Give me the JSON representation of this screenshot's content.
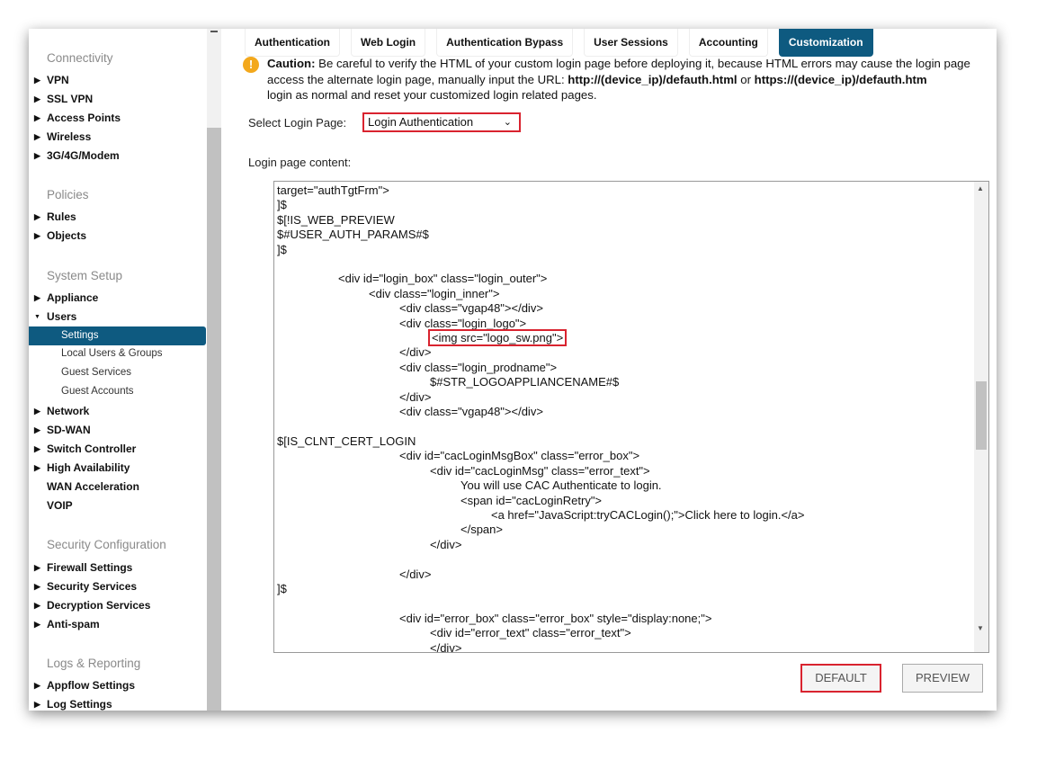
{
  "sidebar": {
    "sections": [
      {
        "title": "Connectivity",
        "items": [
          "VPN",
          "SSL VPN",
          "Access Points",
          "Wireless",
          "3G/4G/Modem"
        ]
      },
      {
        "title": "Policies",
        "items": [
          "Rules",
          "Objects"
        ]
      },
      {
        "title": "System Setup",
        "items": [
          "Appliance",
          "Users"
        ],
        "users_sub": [
          "Settings",
          "Local Users & Groups",
          "Guest Services",
          "Guest Accounts"
        ],
        "items2": [
          "Network",
          "SD-WAN",
          "Switch Controller",
          "High Availability",
          "WAN Acceleration",
          "VOIP"
        ]
      },
      {
        "title": "Security Configuration",
        "items": [
          "Firewall Settings",
          "Security Services",
          "Decryption Services",
          "Anti-spam"
        ]
      },
      {
        "title": "Logs & Reporting",
        "items": [
          "Appflow Settings",
          "Log Settings"
        ]
      }
    ],
    "selected": "Settings"
  },
  "tabs": [
    "Authentication",
    "Web Login",
    "Authentication Bypass",
    "User Sessions",
    "Accounting",
    "Customization"
  ],
  "active_tab": "Customization",
  "caution": {
    "label": "Caution:",
    "text1": " Be careful to verify the HTML of your custom login page before deploying it, because HTML errors may cause the login page",
    "text2": "access the alternate login page, manually input the URL: ",
    "url1": "http://(device_ip)/defauth.html",
    "or": " or ",
    "url2": "https://(device_ip)/defauth.htm",
    "text3": "login as normal and reset your customized login related pages."
  },
  "select_label": "Select Login Page:",
  "select_value": "Login Authentication",
  "content_label": "Login page content:",
  "code_before": "target=\"authTgtFrm\">\n]$\n$[!IS_WEB_PREVIEW\n$#USER_AUTH_PARAMS#$\n]$\n\n\t\t<div id=\"login_box\" class=\"login_outer\">\n\t\t\t<div class=\"login_inner\">\n\t\t\t\t<div class=\"vgap48\"></div>\n\t\t\t\t<div class=\"login_logo\">\n\t\t\t\t\t",
  "code_highlight": "<img src=\"logo_sw.png\">",
  "code_after": "\n\t\t\t\t</div>\n\t\t\t\t<div class=\"login_prodname\">\n\t\t\t\t\t$#STR_LOGOAPPLIANCENAME#$\n\t\t\t\t</div>\n\t\t\t\t<div class=\"vgap48\"></div>\n\n$[IS_CLNT_CERT_LOGIN\n\t\t\t\t<div id=\"cacLoginMsgBox\" class=\"error_box\">\n\t\t\t\t\t<div id=\"cacLoginMsg\" class=\"error_text\">\n\t\t\t\t\t\tYou will use CAC Authenticate to login.\n\t\t\t\t\t\t<span id=\"cacLoginRetry\">\n\t\t\t\t\t\t\t<a href=\"JavaScript:tryCACLogin();\">Click here to login.</a>\n\t\t\t\t\t\t</span>\n\t\t\t\t\t</div>\n\n\t\t\t\t</div>\n]$\n\n\t\t\t\t<div id=\"error_box\" class=\"error_box\" style=\"display:none;\">\n\t\t\t\t\t<div id=\"error_text\" class=\"error_text\">\n\t\t\t\t\t</div>",
  "buttons": {
    "default": "DEFAULT",
    "preview": "PREVIEW"
  },
  "colors": {
    "accent": "#0e5a80",
    "highlight": "#d9232f",
    "warning": "#f3a81c"
  }
}
